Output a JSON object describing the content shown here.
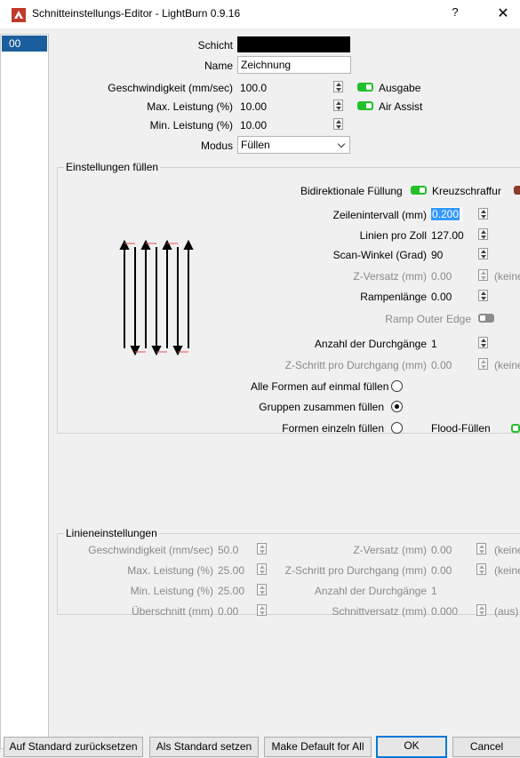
{
  "window": {
    "title": "Schnitteinstellungs-Editor - LightBurn 0.9.16",
    "help_label": "?",
    "close_label": "✕",
    "icon": "lightburn-logo-icon"
  },
  "layers": [
    {
      "label": "00",
      "color": "#000000",
      "selected": true
    }
  ],
  "general": {
    "schicht_label": "Schicht",
    "schicht_color": "#000000",
    "name_label": "Name",
    "name_value": "Zeichnung",
    "speed_label": "Geschwindigkeit (mm/sec)",
    "speed_value": "100.0",
    "max_power_label": "Max. Leistung (%)",
    "max_power_value": "10.00",
    "min_power_label": "Min. Leistung (%)",
    "min_power_value": "10.00",
    "mode_label": "Modus",
    "mode_value": "Füllen",
    "output_label": "Ausgabe",
    "air_assist_label": "Air Assist"
  },
  "fill": {
    "group_title": "Einstellungen füllen",
    "bidirectional_label": "Bidirektionale Füllung",
    "crosshatch_label": "Kreuzschraffur",
    "line_interval_label": "Zeilenintervall (mm)",
    "line_interval_value": "0.200",
    "lines_per_inch_label": "Linien pro Zoll",
    "lines_per_inch_value": "127.00",
    "scan_angle_label": "Scan-Winkel (Grad)",
    "scan_angle_value": "90",
    "z_offset_label": "Z-Versatz (mm)",
    "z_offset_value": "0.00",
    "z_offset_suffix": "(keine",
    "ramp_length_label": "Rampenlänge",
    "ramp_length_value": "0.00",
    "ramp_outer_edge_label": "Ramp Outer Edge",
    "passes_label": "Anzahl der Durchgänge",
    "passes_value": "1",
    "z_step_label": "Z-Schritt pro Durchgang (mm)",
    "z_step_value": "0.00",
    "z_step_suffix": "(keine",
    "fill_all_label": "Alle Formen auf einmal füllen",
    "fill_groups_label": "Gruppen zusammen füllen",
    "fill_individual_label": "Formen einzeln füllen",
    "flood_fill_label": "Flood-Füllen",
    "selected_radio": "fill_groups",
    "preview_icon": "bidirectional-fill-preview-icon"
  },
  "line": {
    "group_title": "Linieneinstellungen",
    "speed_label": "Geschwindigkeit (mm/sec)",
    "speed_value": "50.0",
    "max_power_label": "Max. Leistung (%)",
    "max_power_value": "25.00",
    "min_power_label": "Min. Leistung (%)",
    "min_power_value": "25.00",
    "overcut_label": "Überschnitt (mm)",
    "overcut_value": "0.00",
    "z_offset_label": "Z-Versatz (mm)",
    "z_offset_value": "0.00",
    "z_offset_suffix": "(keine",
    "z_step_label": "Z-Schritt pro Durchgang (mm)",
    "z_step_value": "0.00",
    "z_step_suffix": "(keine",
    "passes_label": "Anzahl der Durchgänge",
    "passes_value": "1",
    "kerf_label": "Schnittversatz (mm)",
    "kerf_value": "0.000",
    "kerf_suffix": "(aus)"
  },
  "buttons": {
    "reset_default": "Auf Standard zurücksetzen",
    "set_default": "Als Standard setzen",
    "make_default_all": "Make Default for All",
    "ok": "OK",
    "cancel": "Cancel"
  }
}
